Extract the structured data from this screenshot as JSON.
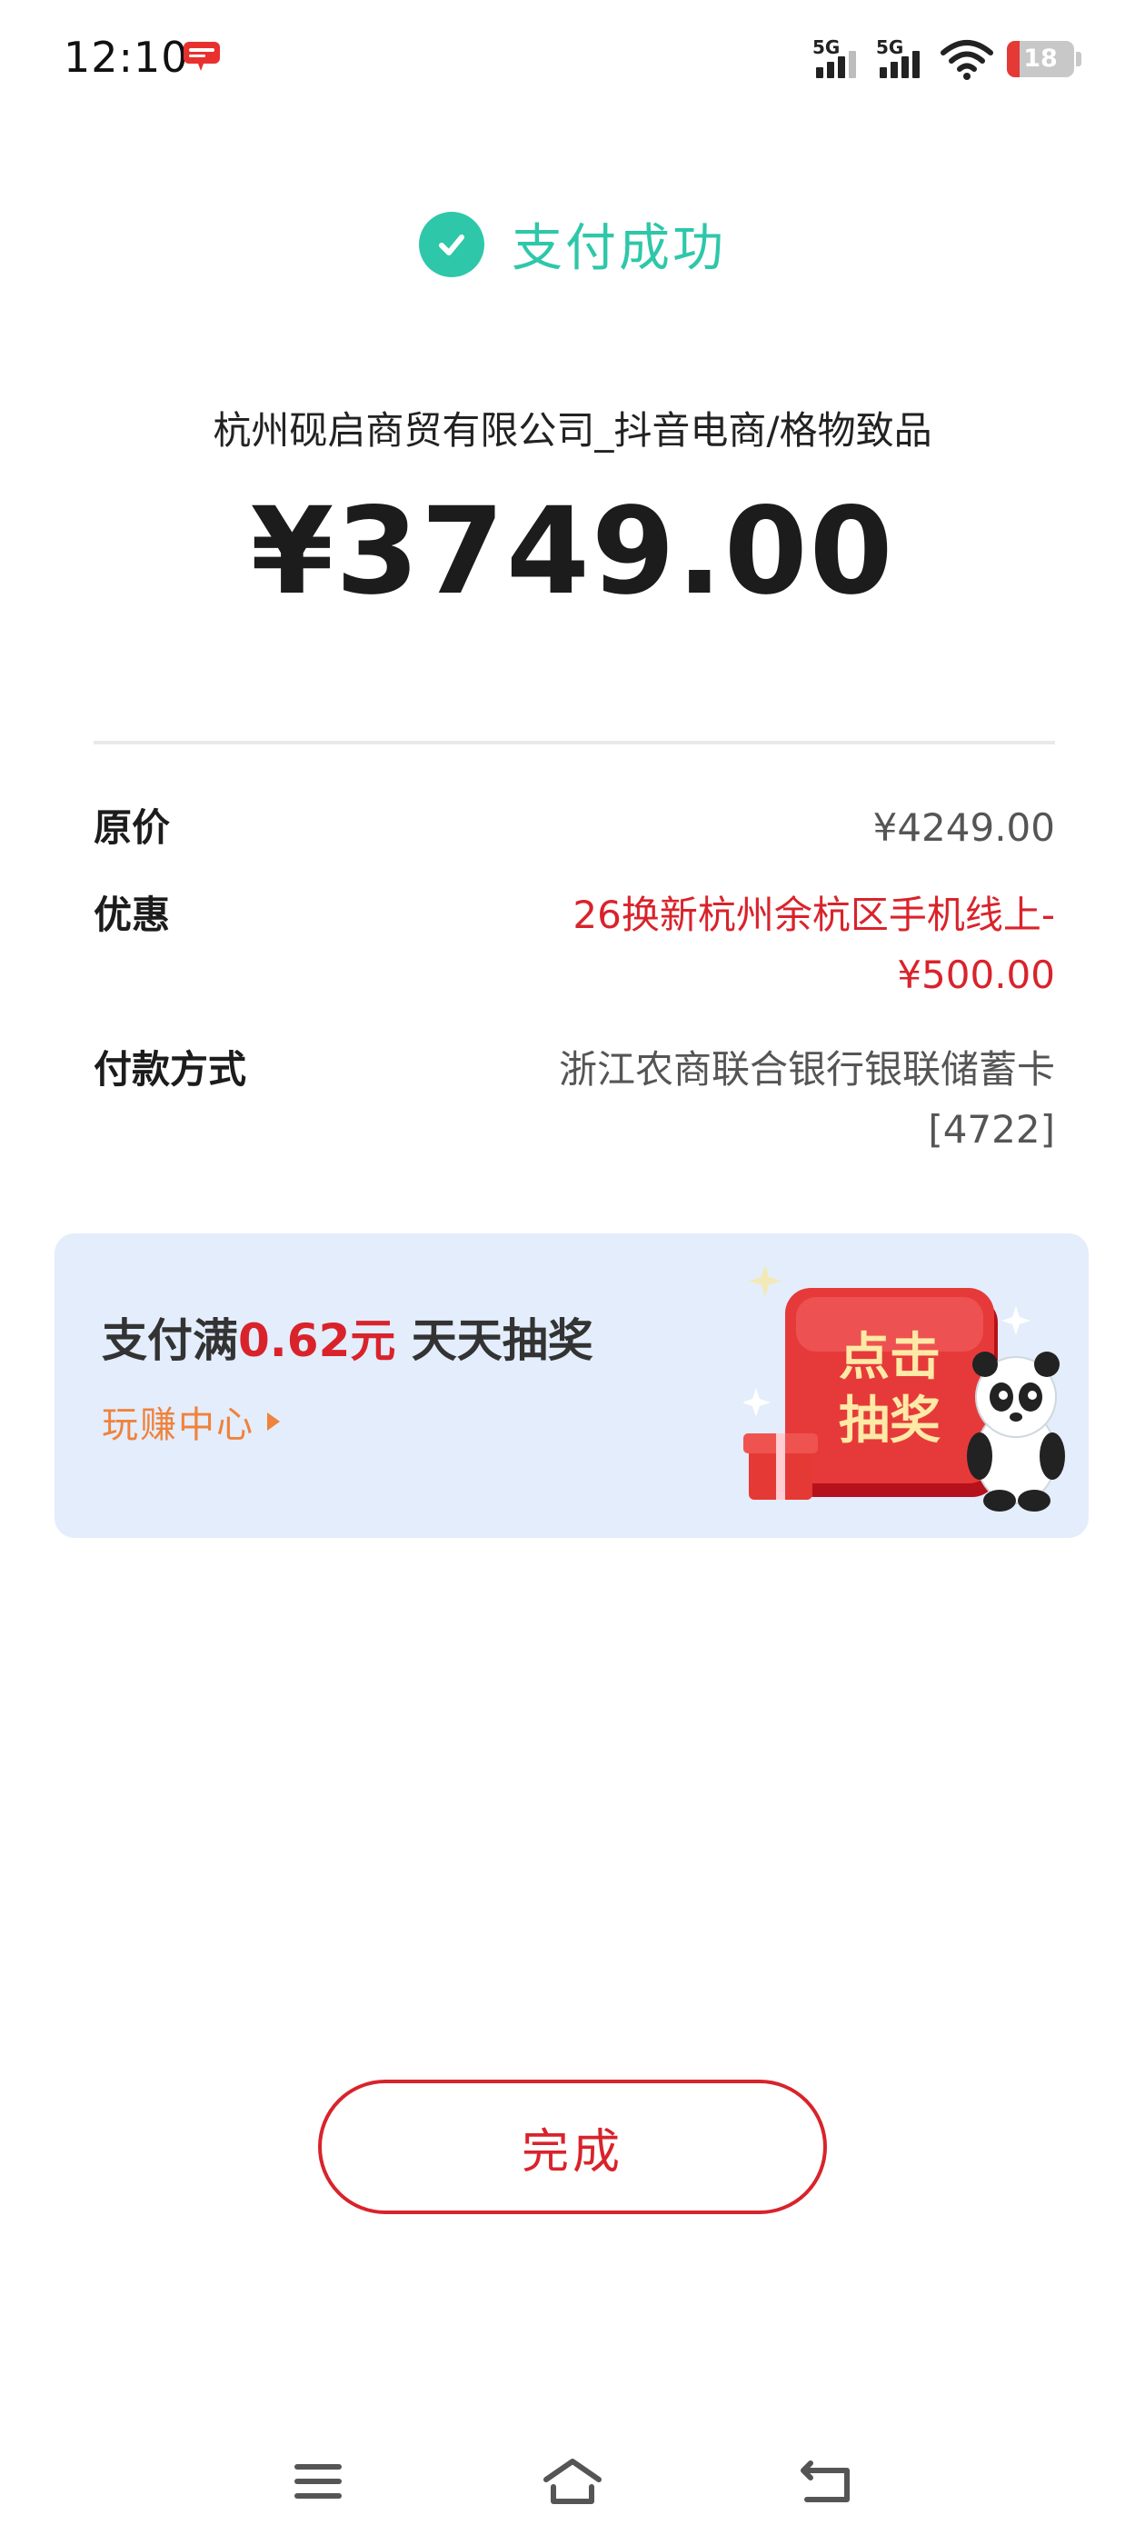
{
  "status_bar": {
    "time": "12:10",
    "signal1_label": "5G",
    "signal2_label": "5G",
    "battery": "18",
    "battery_color": "#e53935"
  },
  "header": {
    "success_text": "支付成功",
    "success_color": "#2ec7a9",
    "merchant": "杭州砚启商贸有限公司_抖音电商/格物致品",
    "amount": "¥3749.00"
  },
  "details": {
    "original_price_label": "原价",
    "original_price_value": "¥4249.00",
    "discount_label": "优惠",
    "discount_line1": "26换新杭州余杭区手机线上-",
    "discount_line2": "¥500.00",
    "payment_label": "付款方式",
    "payment_line1": "浙江农商联合银行银联储蓄卡",
    "payment_line2": "[4722]"
  },
  "promo": {
    "title_prefix": "支付满",
    "title_amount": "0.62元",
    "title_suffix": "天天抽奖",
    "link_text": "玩赚中心",
    "art_line1": "点击",
    "art_line2": "抽奖"
  },
  "actions": {
    "done_label": "完成",
    "accent_color": "#d9232b"
  },
  "nav": {
    "icons": [
      "menu-icon",
      "home-icon",
      "back-icon"
    ]
  }
}
